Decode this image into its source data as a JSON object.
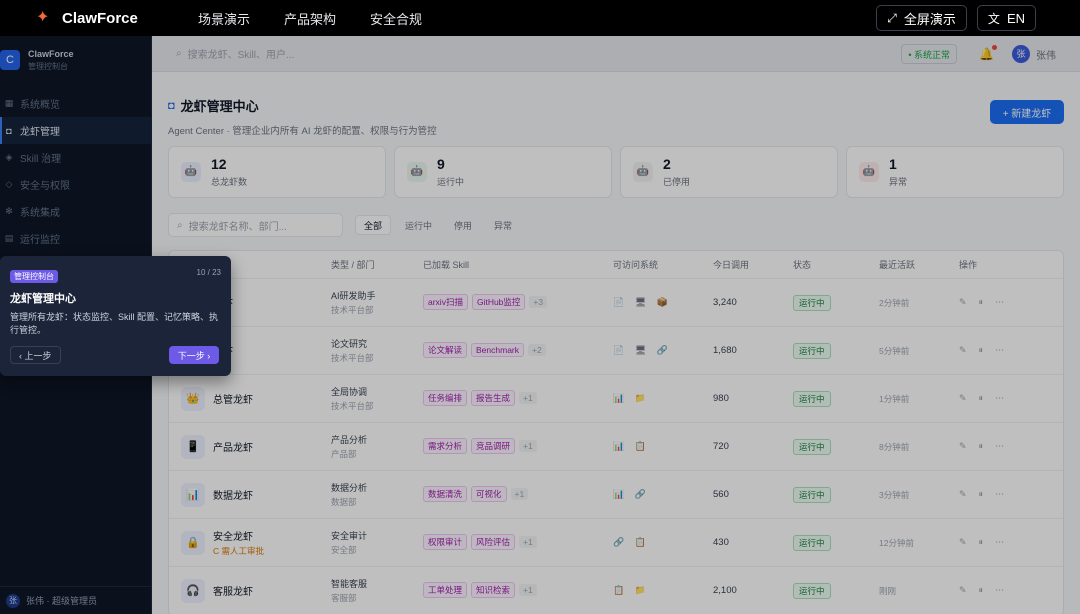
{
  "topbar": {
    "brand": "ClawForce",
    "nav": [
      "场景演示",
      "产品架构",
      "安全合规"
    ],
    "fullscreen_label": "全屏演示",
    "lang_label": "EN"
  },
  "sidebar": {
    "brand_name": "ClawForce",
    "brand_sub": "管理控制台",
    "items": [
      {
        "label": "系统概览"
      },
      {
        "label": "龙虾管理"
      },
      {
        "label": "Skill 治理"
      },
      {
        "label": "安全与权限"
      },
      {
        "label": "系统集成"
      },
      {
        "label": "运行监控"
      }
    ],
    "user": "张伟 · 超级管理员"
  },
  "subheader": {
    "search_placeholder": "搜索龙虾、Skill、用户...",
    "health_label": "• 系统正常",
    "user_name": "张伟",
    "user_initial": "张"
  },
  "page": {
    "title": "龙虾管理中心",
    "subtitle": "Agent Center · 管理企业内所有 AI 龙虾的配置、权限与行为管控",
    "new_button": "+ 新建龙虾"
  },
  "stats": [
    {
      "value": "12",
      "label": "总龙虾数",
      "icon": "🤖",
      "color": "#eaf1ff"
    },
    {
      "value": "9",
      "label": "运行中",
      "icon": "🤖",
      "color": "#e9f9ef"
    },
    {
      "value": "2",
      "label": "已停用",
      "icon": "🤖",
      "color": "#f1f3f6"
    },
    {
      "value": "1",
      "label": "异常",
      "icon": "🤖",
      "color": "#fdecec"
    }
  ],
  "filters": {
    "search_placeholder": "搜索龙虾名称、部门...",
    "chips": [
      "全部",
      "运行中",
      "停用",
      "异常"
    ]
  },
  "table": {
    "headers": [
      "",
      "类型 / 部门",
      "已加载 Skill",
      "可访问系统",
      "今日调用",
      "状态",
      "最近活跃",
      "操作"
    ],
    "rows": [
      {
        "icon": "🦞",
        "name": "龙虾",
        "note": "",
        "type": "AI研发助手",
        "dept": "技术平台部",
        "skills": [
          "arxiv扫描",
          "GitHub监控"
        ],
        "more": "+3",
        "systems": "📄 🖥 📦",
        "calls": "3,240",
        "status": "运行中",
        "last": "2分钟前"
      },
      {
        "icon": "🦞",
        "name": "龙虾",
        "note": "",
        "type": "论文研究",
        "dept": "技术平台部",
        "skills": [
          "论文解读",
          "Benchmark"
        ],
        "more": "+2",
        "systems": "📄 🖥 🔗",
        "calls": "1,680",
        "status": "运行中",
        "last": "5分钟前"
      },
      {
        "icon": "👑",
        "name": "总管龙虾",
        "note": "",
        "type": "全局协调",
        "dept": "技术平台部",
        "skills": [
          "任务编排",
          "报告生成"
        ],
        "more": "+1",
        "systems": "📊 📁",
        "calls": "980",
        "status": "运行中",
        "last": "1分钟前"
      },
      {
        "icon": "📱",
        "name": "产品龙虾",
        "note": "",
        "type": "产品分析",
        "dept": "产品部",
        "skills": [
          "需求分析",
          "竞品调研"
        ],
        "more": "+1",
        "systems": "📊 📋",
        "calls": "720",
        "status": "运行中",
        "last": "8分钟前"
      },
      {
        "icon": "📊",
        "name": "数据龙虾",
        "note": "",
        "type": "数据分析",
        "dept": "数据部",
        "skills": [
          "数据清洗",
          "可视化"
        ],
        "more": "+1",
        "systems": "📊 🔗",
        "calls": "560",
        "status": "运行中",
        "last": "3分钟前"
      },
      {
        "icon": "🔒",
        "name": "安全龙虾",
        "note": "C 需人工审批",
        "type": "安全审计",
        "dept": "安全部",
        "skills": [
          "权限审计",
          "风险评估"
        ],
        "more": "+1",
        "systems": "🔗 📋",
        "calls": "430",
        "status": "运行中",
        "last": "12分钟前"
      },
      {
        "icon": "🎧",
        "name": "客服龙虾",
        "note": "",
        "type": "智能客服",
        "dept": "客服部",
        "skills": [
          "工单处理",
          "知识检索"
        ],
        "more": "+1",
        "systems": "📋 📁",
        "calls": "2,100",
        "status": "运行中",
        "last": "刚刚"
      }
    ]
  },
  "tour": {
    "badge": "管理控制台",
    "step": "10 / 23",
    "title": "龙虾管理中心",
    "desc": "管理所有龙虾：状态监控、Skill 配置、记忆策略、执行管控。",
    "prev_label": "‹ 上一步",
    "next_label": "下一步 ›"
  }
}
